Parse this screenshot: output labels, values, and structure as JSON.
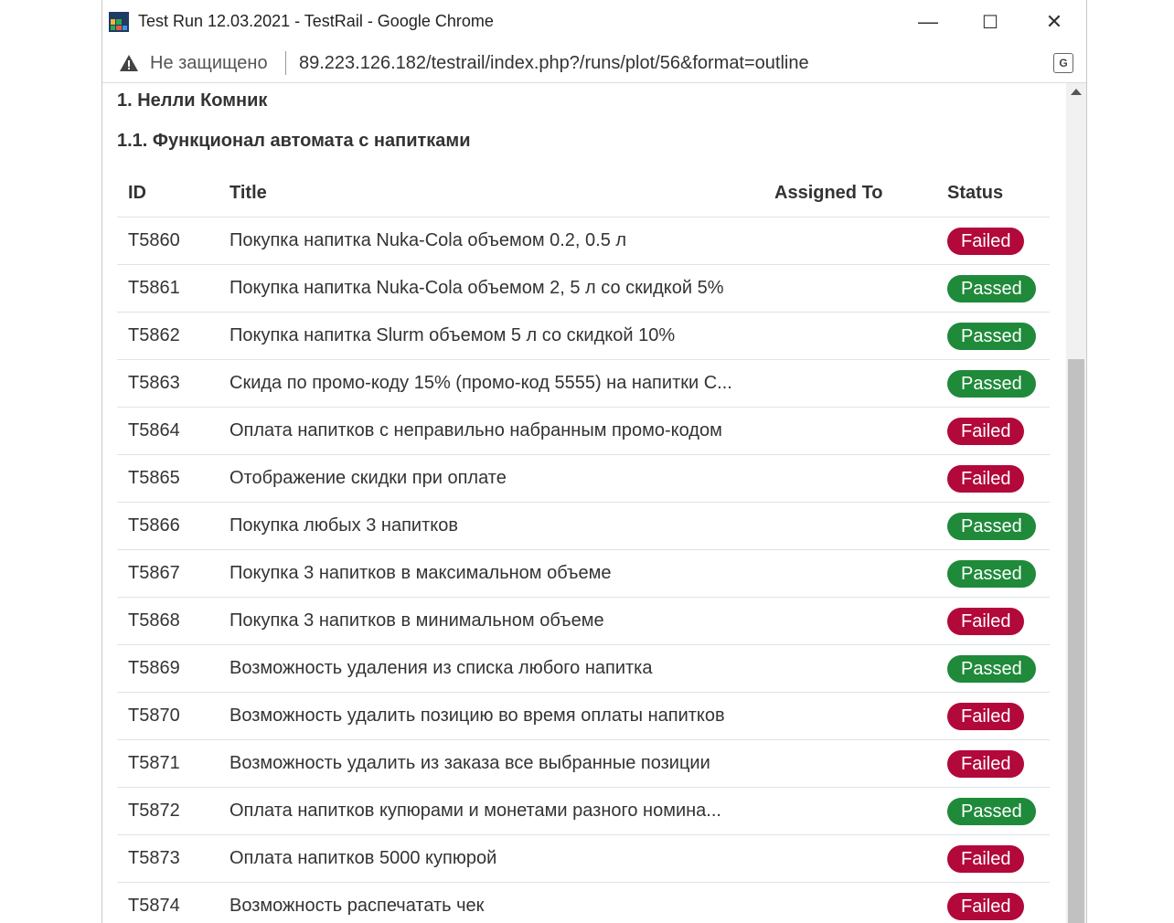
{
  "window": {
    "title": "Test Run 12.03.2021 - TestRail - Google Chrome",
    "minimize": "—",
    "maximize": "☐",
    "close": "✕"
  },
  "addressbar": {
    "security_label": "Не защищено",
    "url": "89.223.126.182/testrail/index.php?/runs/plot/56&format=outline"
  },
  "page": {
    "section": "1. Нелли Комник",
    "subsection": "1.1. Функционал автомата с напитками",
    "columns": {
      "id": "ID",
      "title": "Title",
      "assigned": "Assigned To",
      "status": "Status"
    },
    "rows": [
      {
        "id": "T5860",
        "title": "Покупка напитка Nuka-Cola объемом 0.2, 0.5 л",
        "assigned": "",
        "status": "Failed"
      },
      {
        "id": "T5861",
        "title": "Покупка напитка Nuka-Cola объемом 2, 5 л со скидкой 5%",
        "assigned": "",
        "status": "Passed"
      },
      {
        "id": "T5862",
        "title": "Покупка напитка Slurm объемом 5 л со скидкой 10%",
        "assigned": "",
        "status": "Passed"
      },
      {
        "id": "T5863",
        "title": "Скида по промо-коду 15% (промо-код 5555) на напитки С...",
        "assigned": "",
        "status": "Passed"
      },
      {
        "id": "T5864",
        "title": "Оплата напитков с неправильно набранным промо-кодом",
        "assigned": "",
        "status": "Failed"
      },
      {
        "id": "T5865",
        "title": "Отображение скидки при оплате",
        "assigned": "",
        "status": "Failed"
      },
      {
        "id": "T5866",
        "title": "Покупка любых 3 напитков",
        "assigned": "",
        "status": "Passed"
      },
      {
        "id": "T5867",
        "title": "Покупка 3 напитков в максимальном объеме",
        "assigned": "",
        "status": "Passed"
      },
      {
        "id": "T5868",
        "title": "Покупка 3 напитков в минимальном объеме",
        "assigned": "",
        "status": "Failed"
      },
      {
        "id": "T5869",
        "title": "Возможность удаления из списка любого напитка",
        "assigned": "",
        "status": "Passed"
      },
      {
        "id": "T5870",
        "title": "Возможность удалить позицию во время оплаты напитков",
        "assigned": "",
        "status": "Failed"
      },
      {
        "id": "T5871",
        "title": "Возможность удалить из заказа все выбранные позиции",
        "assigned": "",
        "status": "Failed"
      },
      {
        "id": "T5872",
        "title": "Оплата напитков купюрами и монетами разного номина...",
        "assigned": "",
        "status": "Passed"
      },
      {
        "id": "T5873",
        "title": "Оплата напитков 5000 купюрой",
        "assigned": "",
        "status": "Failed"
      },
      {
        "id": "T5874",
        "title": "Возможность распечатать чек",
        "assigned": "",
        "status": "Failed"
      }
    ]
  },
  "colors": {
    "failed": "#b2083a",
    "passed": "#1f8a3a"
  },
  "icons": {
    "warning": "warning-icon",
    "translate": "translate-icon",
    "app": "testrail-app-icon"
  }
}
